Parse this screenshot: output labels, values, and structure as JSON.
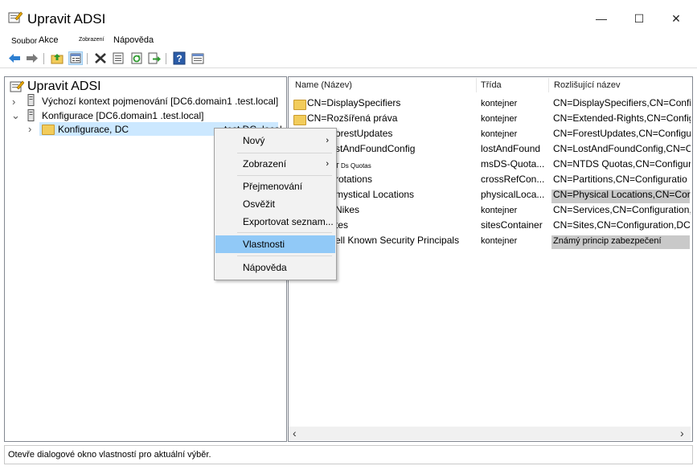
{
  "window": {
    "title": "Upravit ADSI",
    "minimize_glyph": "—",
    "maximize_glyph": "☐",
    "close_glyph": "✕",
    "icon": "adsi-edit-icon"
  },
  "menu": {
    "soubor": "Soubor",
    "akce": "Akce",
    "zobrazeni": "Zobrazení",
    "napoveda": "Nápověda"
  },
  "toolbar": {
    "icons": [
      "back-arrow-icon",
      "forward-arrow-icon",
      "up-folder-icon",
      "show-hide-tree-icon",
      "delete-icon",
      "properties-icon",
      "refresh-icon",
      "export-list-icon",
      "help-icon",
      "console-pane-icon"
    ]
  },
  "tree": {
    "root_label": "Upravit ADSI",
    "items": [
      {
        "label": "Výchozí kontext pojmenování [DC6.domain1 .test.local]",
        "expander": "›"
      },
      {
        "label": "Konfigurace [DC6.domain1 .test.local]",
        "expander": "⌄"
      },
      {
        "label": "Konfigurace, DC",
        "suffix": "=test,DC=local",
        "expander": "›"
      }
    ]
  },
  "list": {
    "columns": [
      "Name (Název)",
      "Třída",
      "Rozlišující název"
    ],
    "rows": [
      {
        "name": "CN=DisplaySpecifiers",
        "class": "kontejner",
        "dn": "CN=DisplaySpecifiers,CN=Confi"
      },
      {
        "name": "CN=Rozšířená práva",
        "class": "kontejner",
        "dn": "CN=Extended-Rights,CN=Config"
      },
      {
        "name": "orestUpdates",
        "class": "kontejner",
        "dn": "CN=ForestUpdates,CN=Configu"
      },
      {
        "name": "stAndFoundConfig",
        "class": "lostAndFound",
        "dn": "CN=LostAndFoundConfig,CN=C"
      },
      {
        "name": "T Ds Quotas",
        "class": "msDS-Quota...",
        "dn": "CN=NTDS Quotas,CN=Configur"
      },
      {
        "name": "rotations",
        "class": "crossRefCon...",
        "dn": "CN=Partitions,CN=Configuratio"
      },
      {
        "name": "mystical Locations",
        "class": "physicalLoca...",
        "dn": "CN=Physical Locations,CN=Cor"
      },
      {
        "name": "Nikes",
        "class": "kontejner",
        "dn": "CN=Services,CN=Configuration,"
      },
      {
        "name": "tes",
        "class": "sitesContainer",
        "dn": "CN=Sites,CN=Configuration,DC"
      },
      {
        "name": "ell Known Security Principals",
        "class": "kontejner",
        "dn": "Známý princip zabezpečení"
      }
    ]
  },
  "context_menu": {
    "items": [
      "Nový",
      "Zobrazení",
      "Přejmenování",
      "Osvěžit",
      "Exportovat seznam...",
      "Vlastnosti",
      "Nápověda"
    ],
    "submenu_arrow": "›"
  },
  "scrollbar": {
    "left": "‹",
    "right": "›"
  },
  "status": {
    "text": "Otevře dialogové okno vlastností pro aktuální výběr."
  },
  "colors": {
    "selection": "#cce8ff",
    "highlight_gray": "#c9c9c9",
    "menu_hover": "#91c9f7"
  }
}
